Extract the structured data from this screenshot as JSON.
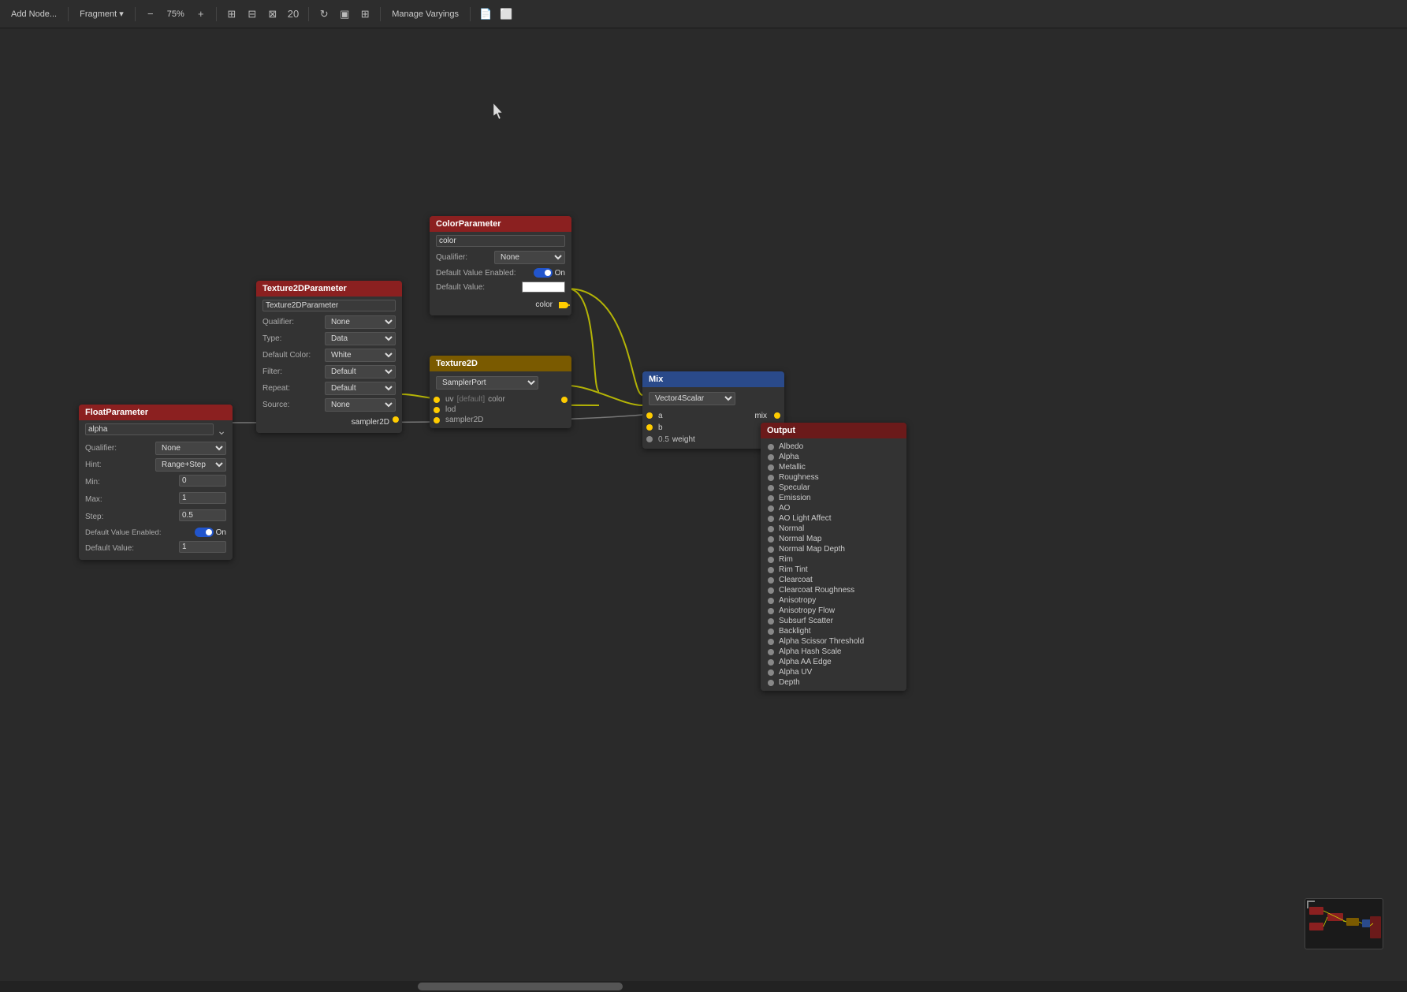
{
  "toolbar": {
    "add_node": "Add Node...",
    "mode": "Fragment",
    "zoom": "75%",
    "manage_varyings": "Manage Varyings",
    "icons": [
      "zoom-out",
      "zoom-in",
      "add-circle",
      "grid-4",
      "grid-adjust",
      "refresh",
      "layout",
      "layout-alt"
    ]
  },
  "nodes": {
    "color_parameter": {
      "title": "ColorParameter",
      "name": "color",
      "qualifier_label": "Qualifier:",
      "qualifier_value": "None",
      "default_enabled_label": "Default Value Enabled:",
      "default_enabled_value": "On",
      "default_value_label": "Default Value:",
      "port_out_label": "color"
    },
    "texture2d_parameter": {
      "title": "Texture2DParameter",
      "name": "Texture2DParameter",
      "qualifier_label": "Qualifier:",
      "qualifier_value": "None",
      "type_label": "Type:",
      "type_value": "Data",
      "default_color_label": "Default Color:",
      "default_color_value": "White",
      "filter_label": "Filter:",
      "filter_value": "Default",
      "repeat_label": "Repeat:",
      "repeat_value": "Default",
      "source_label": "Source:",
      "source_value": "None",
      "port_out_label": "sampler2D"
    },
    "float_parameter": {
      "title": "FloatParameter",
      "name": "alpha",
      "qualifier_label": "Qualifier:",
      "qualifier_value": "None",
      "hint_label": "Hint:",
      "hint_value": "Range+Step",
      "min_label": "Min:",
      "min_value": "0",
      "max_label": "Max:",
      "max_value": "1",
      "step_label": "Step:",
      "step_value": "0.5",
      "default_enabled_label": "Default Value Enabled:",
      "default_enabled_value": "On",
      "default_value_label": "Default Value:",
      "default_value_value": "1"
    },
    "texture2d": {
      "title": "Texture2D",
      "sampler_port": "SamplerPort",
      "port_uv": "uv",
      "port_uv_sub": "[default]",
      "port_uv_type": "color",
      "port_lod": "lod",
      "port_sampler2d": "sampler2D",
      "port_out_label": "color"
    },
    "mix": {
      "title": "Mix",
      "type": "Vector4Scalar",
      "port_a": "a",
      "port_b": "b",
      "port_weight_val": "0.5",
      "port_weight_label": "weight",
      "port_out_label": "mix"
    },
    "output": {
      "title": "Output",
      "ports": [
        {
          "label": "Albedo",
          "color": "#888"
        },
        {
          "label": "Alpha",
          "color": "#888"
        },
        {
          "label": "Metallic",
          "color": "#888"
        },
        {
          "label": "Roughness",
          "color": "#888"
        },
        {
          "label": "Specular",
          "color": "#888"
        },
        {
          "label": "Emission",
          "color": "#888"
        },
        {
          "label": "AO",
          "color": "#888"
        },
        {
          "label": "AO Light Affect",
          "color": "#888"
        },
        {
          "label": "Normal",
          "color": "#888"
        },
        {
          "label": "Normal Map",
          "color": "#888"
        },
        {
          "label": "Normal Map Depth",
          "color": "#888"
        },
        {
          "label": "Rim",
          "color": "#888"
        },
        {
          "label": "Rim Tint",
          "color": "#888"
        },
        {
          "label": "Clearcoat",
          "color": "#888"
        },
        {
          "label": "Clearcoat Roughness",
          "color": "#888"
        },
        {
          "label": "Anisotropy",
          "color": "#888"
        },
        {
          "label": "Anisotropy Flow",
          "color": "#888"
        },
        {
          "label": "Subsurf Scatter",
          "color": "#888"
        },
        {
          "label": "Backlight",
          "color": "#888"
        },
        {
          "label": "Alpha Scissor Threshold",
          "color": "#888"
        },
        {
          "label": "Alpha Hash Scale",
          "color": "#888"
        },
        {
          "label": "Alpha AA Edge",
          "color": "#888"
        },
        {
          "label": "Alpha UV",
          "color": "#888"
        },
        {
          "label": "Depth",
          "color": "#888"
        }
      ]
    }
  }
}
